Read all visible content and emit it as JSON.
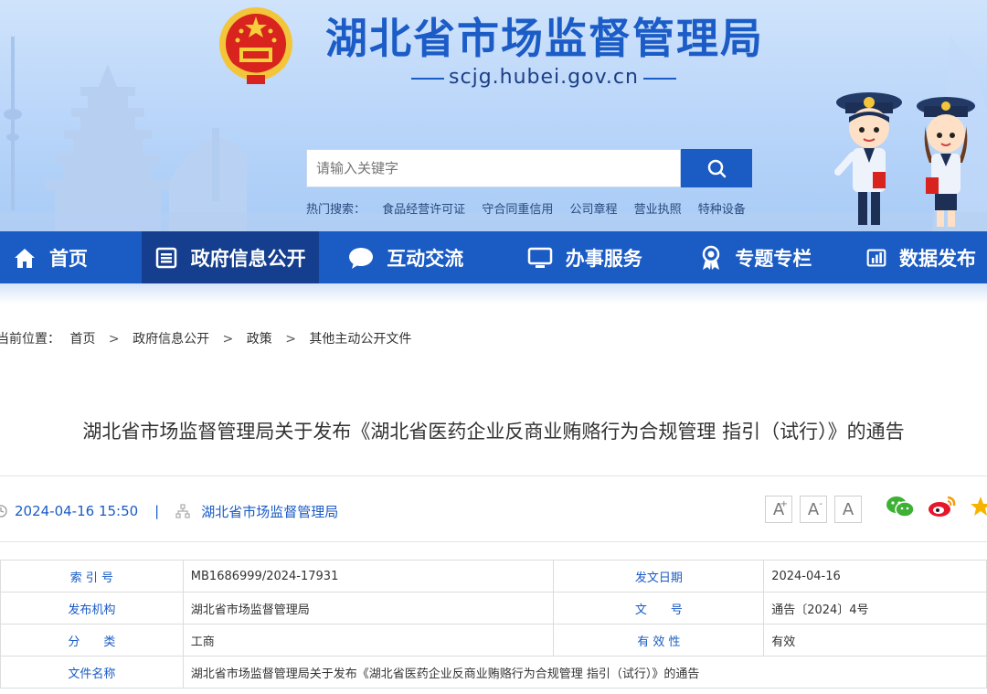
{
  "header": {
    "title": "湖北省市场监督管理局",
    "domain": "scjg.hubei.gov.cn",
    "search_placeholder": "请输入关键字",
    "hot_label": "热门搜索：",
    "hot_links": [
      "食品经营许可证",
      "守合同重信用",
      "公司章程",
      "营业执照",
      "特种设备"
    ],
    "brand_color": "#1a5bc4"
  },
  "nav": {
    "items": [
      {
        "label": "首页",
        "icon": "home-icon"
      },
      {
        "label": "政府信息公开",
        "icon": "document-list-icon"
      },
      {
        "label": "互动交流",
        "icon": "chat-bubble-icon"
      },
      {
        "label": "办事服务",
        "icon": "monitor-icon"
      },
      {
        "label": "专题专栏",
        "icon": "award-icon"
      },
      {
        "label": "数据发布",
        "icon": "bar-chart-icon"
      }
    ],
    "active_index": 1
  },
  "breadcrumb": {
    "prefix": "当前位置：",
    "items": [
      "首页",
      "政府信息公开",
      "政策",
      "其他主动公开文件"
    ],
    "separator": ">"
  },
  "article": {
    "title": "湖北省市场监督管理局关于发布《湖北省医药企业反商业贿赂行为合规管理 指引（试行）》的通告",
    "datetime": "2024-04-16 15:50",
    "separator": "|",
    "source": "湖北省市场监督管理局",
    "font_buttons": [
      "A",
      "A",
      "A"
    ],
    "font_button_marks": [
      "+",
      "-",
      ""
    ]
  },
  "info_table": {
    "rows": [
      {
        "label1": "索 引 号",
        "value1": "MB1686999/2024-17931",
        "label2": "发文日期",
        "value2": "2024-04-16"
      },
      {
        "label1": "发布机构",
        "value1": "湖北省市场监督管理局",
        "label2": "文　　号",
        "value2": "通告〔2024〕4号"
      },
      {
        "label1": "分　　类",
        "value1": "工商",
        "label2": "有 效 性",
        "value2": "有效"
      }
    ],
    "name_label": "文件名称",
    "name_value": "湖北省市场监督管理局关于发布《湖北省医药企业反商业贿赂行为合规管理 指引（试行）》的通告"
  }
}
